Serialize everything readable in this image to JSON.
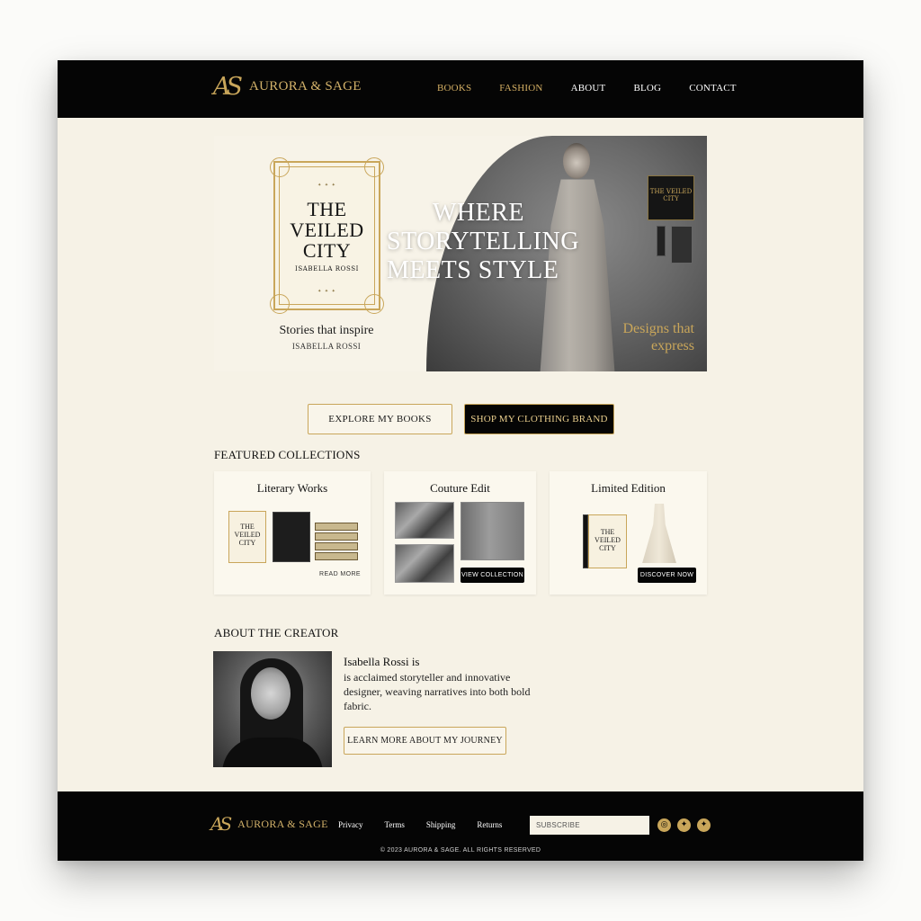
{
  "header": {
    "monogram": "AS",
    "brand": "AURORA & SAGE",
    "nav": [
      {
        "label": "BOOKS"
      },
      {
        "label": "FASHION"
      },
      {
        "label": "ABOUT"
      },
      {
        "label": "BLOG"
      },
      {
        "label": "CONTACT"
      }
    ]
  },
  "hero": {
    "book_title_line1": "THE",
    "book_title_line2": "VEILED",
    "book_title_line3": "CITY",
    "book_author": "ISABELLA ROSSI",
    "headline_line1": "WHERE",
    "headline_line2": "STORYTELLING",
    "headline_line3": "MEETS STYLE",
    "subtitle": "Stories that inspire",
    "author": "ISABELLA ROSSI",
    "tagline_line1": "Designs that",
    "tagline_line2": "express",
    "mini_book_text": "THE VEILED CITY"
  },
  "cta": {
    "books": "EXPLORE MY BOOKS",
    "clothing": "SHOP MY CLOTHING BRAND"
  },
  "featured": {
    "title": "FEATURED COLLECTIONS",
    "cards": [
      {
        "title": "Literary Works",
        "action": "READ MORE",
        "book_label": "THE VEILED CITY"
      },
      {
        "title": "Couture Edit",
        "action": "VIEW COLLECTION"
      },
      {
        "title": "Limited Edition",
        "action": "DISCOVER NOW",
        "book_label": "THE VEILED CITY"
      }
    ]
  },
  "about": {
    "title": "ABOUT THE CREATOR",
    "name": "Isabella Rossi is",
    "text": "is acclaimed storyteller and innovative designer, weaving narratives into both bold fabric.",
    "button": "LEARN MORE ABOUT MY JOURNEY"
  },
  "footer": {
    "monogram": "AS",
    "brand": "AURORA & SAGE",
    "links": [
      {
        "label": "Privacy"
      },
      {
        "label": "Terms"
      },
      {
        "label": "Shipping"
      },
      {
        "label": "Returns"
      }
    ],
    "subscribe_placeholder": "SUBSCRIBE",
    "social": [
      {
        "icon": "instagram-icon",
        "glyph": "◎"
      },
      {
        "icon": "twitter-icon",
        "glyph": "✦"
      },
      {
        "icon": "twitter-icon",
        "glyph": "✦"
      }
    ],
    "copyright": "© 2023 AURORA & SAGE. ALL RIGHTS RESERVED"
  },
  "colors": {
    "gold": "#c9a65a",
    "black": "#050505",
    "cream": "#f6f2e6"
  }
}
